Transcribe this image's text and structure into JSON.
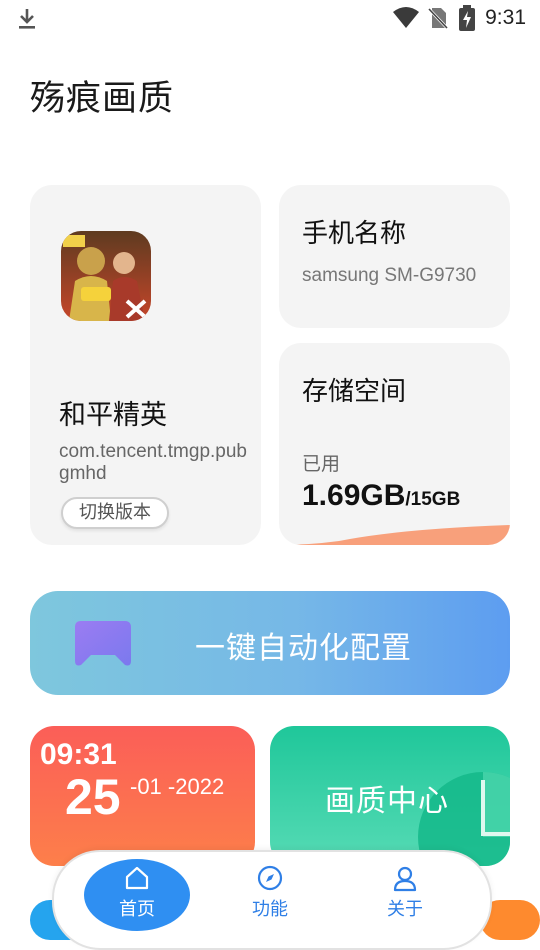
{
  "status_bar": {
    "time": "9:31",
    "icons": [
      "download-icon",
      "wifi-icon",
      "no-sim-icon",
      "battery-charging-icon"
    ]
  },
  "app": {
    "title": "殇痕画质"
  },
  "game_card": {
    "icon": "game-app-icon",
    "name": "和平精英",
    "package": "com.tencent.tmgp.pubgmhd",
    "switch_button": "切换版本"
  },
  "phone_card": {
    "heading": "手机名称",
    "model": "samsung SM-G9730"
  },
  "storage_card": {
    "heading": "存储空间",
    "used_label": "已用",
    "used": "1.69GB",
    "total": "/15GB",
    "used_fraction": 0.113,
    "bar_color": "#f8a07b"
  },
  "auto_config": {
    "label": "一键自动化配置",
    "icon": "gamepad-icon"
  },
  "clock_card": {
    "time": "09:31",
    "day": "25",
    "month_year": "-01 -2022"
  },
  "quality_card": {
    "label": "画质中心"
  },
  "bottom_nav": {
    "items": [
      {
        "label": "首页",
        "icon": "home-icon",
        "active": true
      },
      {
        "label": "功能",
        "icon": "compass-icon",
        "active": false
      },
      {
        "label": "关于",
        "icon": "user-icon",
        "active": false
      }
    ]
  },
  "colors": {
    "accent_blue": "#2f8ff2",
    "clock_gradient": [
      "#fb5e58",
      "#fd7f4a"
    ],
    "quality_gradient": [
      "#1fc79a",
      "#57dbb5"
    ],
    "config_gradient": [
      "#7ec7dd",
      "#5d9df0"
    ]
  }
}
